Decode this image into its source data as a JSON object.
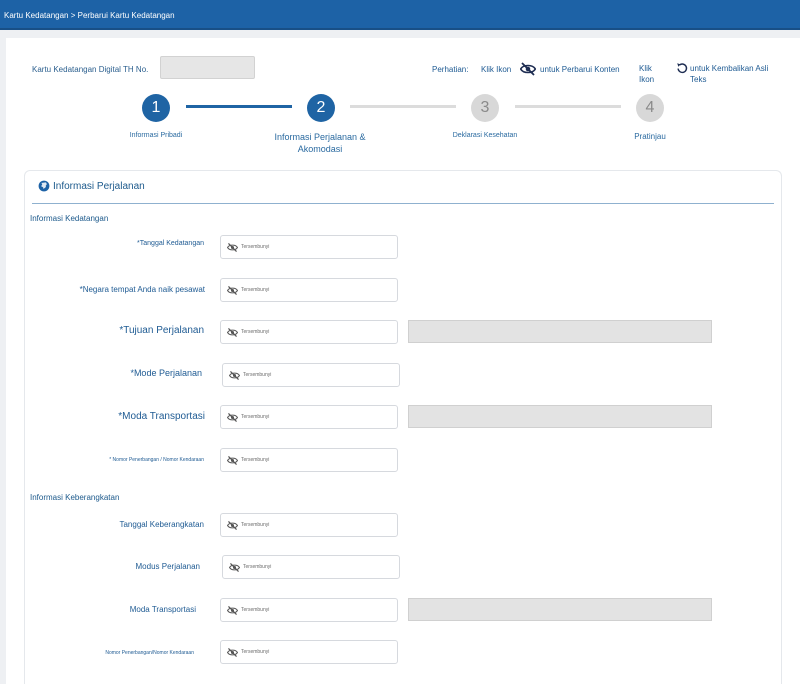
{
  "header": {
    "breadcrumb": "Kartu Kedatangan > Perbarui Kartu Kedatangan"
  },
  "card": {
    "arrival_no_label": "Kartu Kedatangan Digital TH No.",
    "arrival_no_value": ""
  },
  "notice": {
    "label": "Perhatian:",
    "click_icon": "Klik Ikon",
    "update_text": "untuk Perbarui Konten",
    "click_icon_2": "Klik Ikon",
    "restore_text": "untuk Kembalikan Asli Teks"
  },
  "stepper": {
    "steps": [
      {
        "number": "1",
        "label": "Informasi Pribadi"
      },
      {
        "number": "2",
        "label": "Informasi Perjalanan & Akomodasi"
      },
      {
        "number": "3",
        "label": "Deklarasi Kesehatan"
      },
      {
        "number": "4",
        "label": "Pratinjau"
      }
    ]
  },
  "section": {
    "title": "Informasi Perjalanan",
    "arrival_group": "Informasi Kedatangan",
    "departure_group": "Informasi Keberangkatan",
    "hidden_text": "Tersembunyi",
    "arrival_fields": [
      {
        "label": "*Tanggal Kedatangan"
      },
      {
        "label": "*Negara tempat Anda naik pesawat"
      },
      {
        "label": "*Tujuan Perjalanan"
      },
      {
        "label": "*Mode Perjalanan"
      },
      {
        "label": "*Moda Transportasi"
      },
      {
        "label": "* Nomor Penerbangan / Nomor Kendaraan"
      }
    ],
    "departure_fields": [
      {
        "label": "Tanggal Keberangkatan"
      },
      {
        "label": "Modus Perjalanan"
      },
      {
        "label": "Moda Transportasi"
      },
      {
        "label": "Nomor Penerbangan/Nomor Kendaraan"
      }
    ]
  },
  "colors": {
    "brand": "#1d62a6",
    "accent": "#1f64a4",
    "idle": "#d8d8d8"
  },
  "icons": {
    "hide": "eye-slash-icon",
    "restore": "undo-icon",
    "globe": "globe-icon"
  }
}
